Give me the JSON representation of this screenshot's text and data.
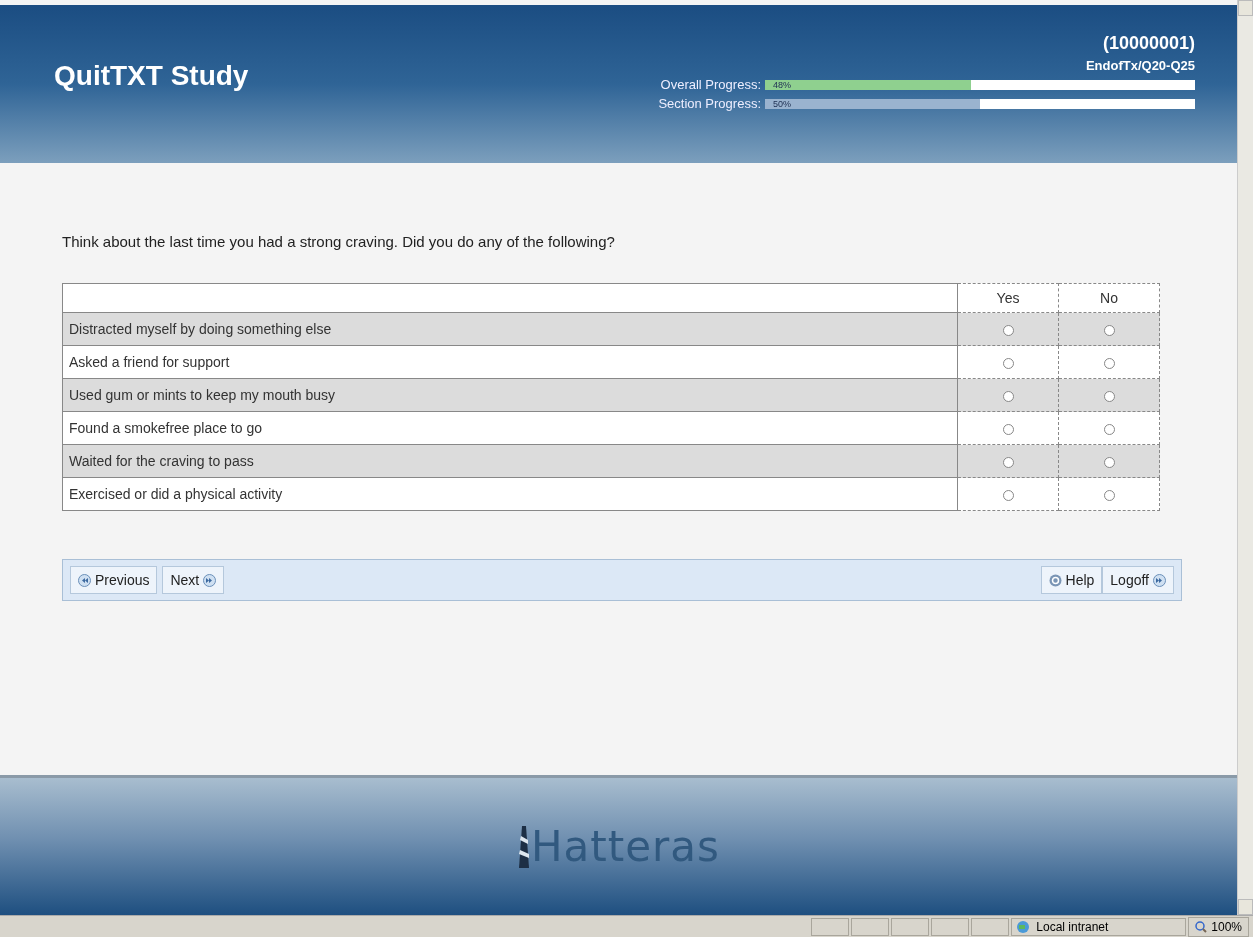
{
  "header": {
    "title": "QuitTXT Study",
    "participant_id": "(10000001)",
    "section": "EndofTx/Q20-Q25",
    "progress": [
      {
        "label": "Overall Progress:",
        "reading": "48%",
        "level": 0.48,
        "color": "#8fd08f"
      },
      {
        "label": "Section Progress:",
        "reading": "50%",
        "level": 0.5,
        "color": "#9ab3cf"
      }
    ]
  },
  "question": "Think about the last time you had a strong craving. Did you do any of the following?",
  "table": {
    "columns": [
      "Yes",
      "No"
    ],
    "rows": [
      {
        "label": "Distracted myself by doing something else",
        "yes": false,
        "no": false
      },
      {
        "label": "Asked a friend for support",
        "yes": false,
        "no": false
      },
      {
        "label": "Used gum or mints to keep my mouth busy",
        "yes": false,
        "no": false
      },
      {
        "label": "Found a smokefree place to go",
        "yes": false,
        "no": false
      },
      {
        "label": "Waited for the craving to pass",
        "yes": false,
        "no": false
      },
      {
        "label": "Exercised or did a physical activity",
        "yes": false,
        "no": false
      }
    ]
  },
  "nav": {
    "left": [
      {
        "label": "Previous",
        "kind": "back"
      },
      {
        "label": "Next",
        "kind": "forward"
      }
    ],
    "right": [
      {
        "label": "Help",
        "kind": "help"
      },
      {
        "label": "Logoff",
        "kind": "forward"
      }
    ]
  },
  "footer": {
    "logo": "Hatteras"
  },
  "status_bar": {
    "zone": "Local intranet",
    "zoom": "100%"
  }
}
